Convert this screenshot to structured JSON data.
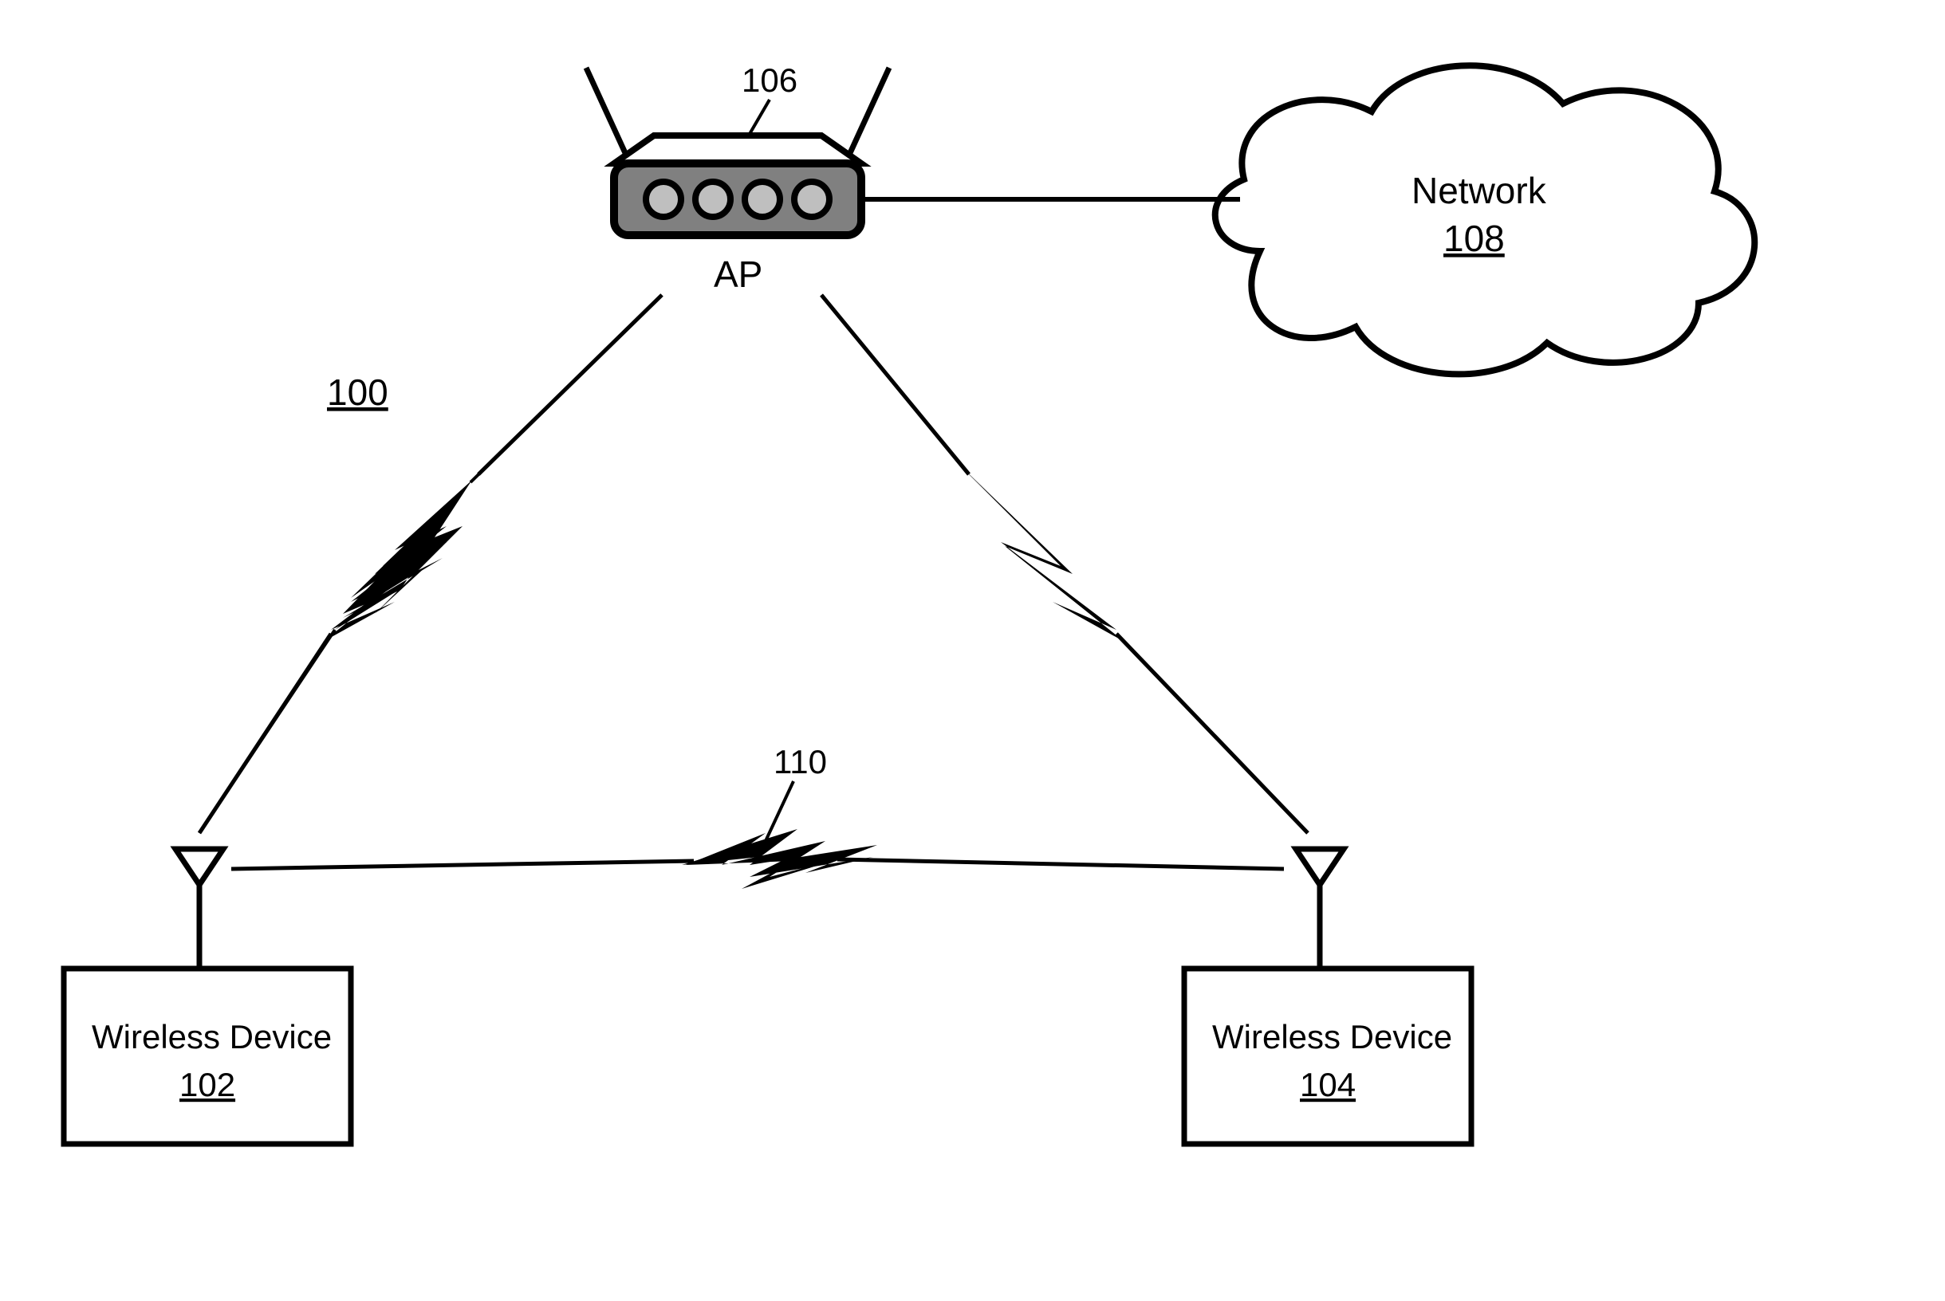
{
  "diagram": {
    "system_ref": "100",
    "ap": {
      "label": "AP",
      "ref": "106"
    },
    "network": {
      "label": "Network",
      "ref": "108"
    },
    "device_left": {
      "label": "Wireless Device",
      "ref": "102"
    },
    "device_right": {
      "label": "Wireless Device",
      "ref": "104"
    },
    "link_p2p_ref": "110"
  }
}
